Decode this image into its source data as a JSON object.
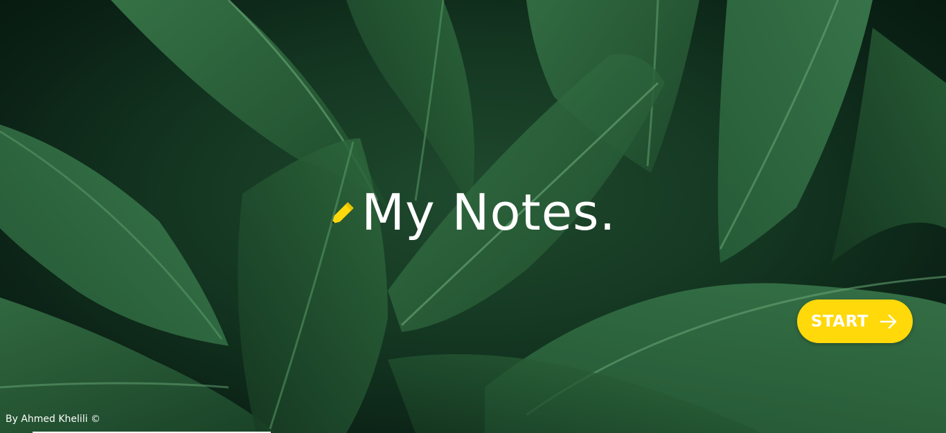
{
  "app": {
    "title": "My Notes.",
    "title_icon": "pencil-icon",
    "accent_color": "#ffd90a"
  },
  "actions": {
    "start_label": "START",
    "start_icon": "arrow-right-icon"
  },
  "footer": {
    "credit": "By Ahmed Khelili ©"
  },
  "background": {
    "description_colors": [
      "#0b2216",
      "#1f4a2e",
      "#2f6a3f"
    ]
  }
}
